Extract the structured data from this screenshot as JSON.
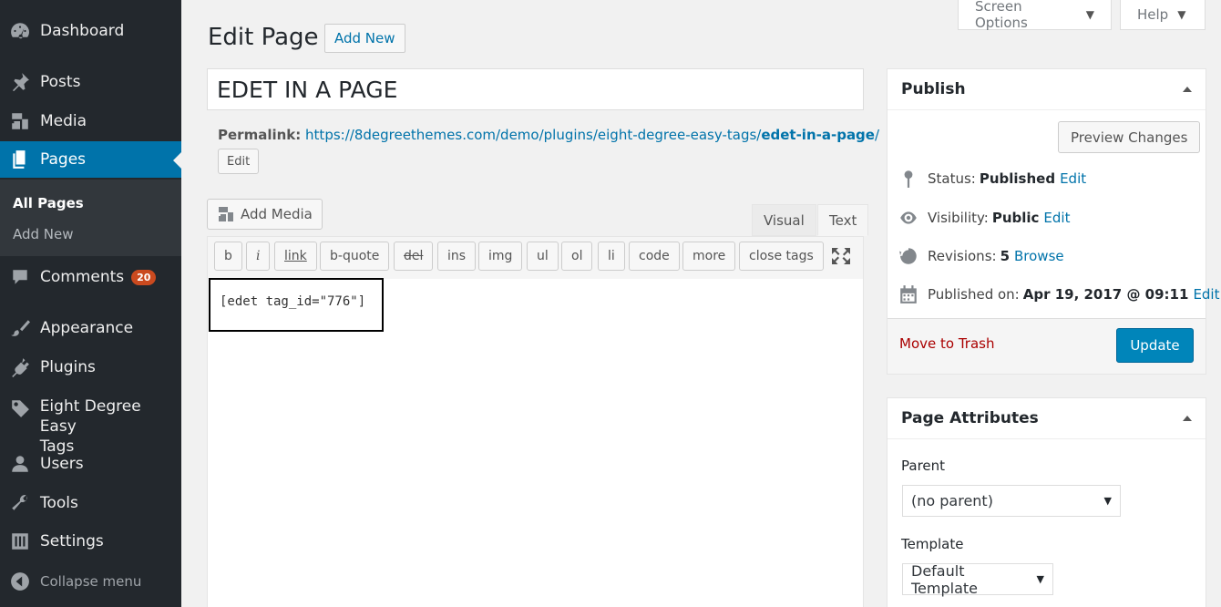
{
  "sidebar": {
    "dashboard": "Dashboard",
    "posts": "Posts",
    "media": "Media",
    "pages": "Pages",
    "submenu": {
      "all_pages": "All Pages",
      "add_new": "Add New"
    },
    "comments": "Comments",
    "comments_count": "20",
    "appearance": "Appearance",
    "plugins": "Plugins",
    "eight_degree_line1": "Eight Degree Easy",
    "eight_degree_line2": "Tags",
    "users": "Users",
    "tools": "Tools",
    "settings": "Settings",
    "collapse": "Collapse menu"
  },
  "top": {
    "screen_options": "Screen Options",
    "help": "Help"
  },
  "header": {
    "title": "Edit Page",
    "add_new": "Add New"
  },
  "post": {
    "title": "EDET IN A PAGE",
    "permalink_label": "Permalink:",
    "permalink_base": "https://8degreethemes.com/demo/plugins/eight-degree-easy-tags/",
    "permalink_slug": "edet-in-a-page",
    "permalink_end": "/",
    "edit_button": "Edit"
  },
  "editor": {
    "add_media": "Add Media",
    "tab_visual": "Visual",
    "tab_text": "Text",
    "buttons": [
      "b",
      "i",
      "link",
      "b-quote",
      "del",
      "ins",
      "img",
      "ul",
      "ol",
      "li",
      "code",
      "more",
      "close tags"
    ],
    "content": "[edet tag_id=\"776\"]"
  },
  "publish": {
    "title": "Publish",
    "preview": "Preview Changes",
    "status_label": "Status:",
    "status_value": "Published",
    "visibility_label": "Visibility:",
    "visibility_value": "Public",
    "revisions_label": "Revisions:",
    "revisions_value": "5",
    "browse": "Browse",
    "published_on_label": "Published on:",
    "published_on_value": "Apr 19, 2017 @ 09:11",
    "edit": "Edit",
    "trash": "Move to Trash",
    "update": "Update"
  },
  "attributes": {
    "title": "Page Attributes",
    "parent_label": "Parent",
    "parent_value": "(no parent)",
    "template_label": "Template",
    "template_value": "Default Template"
  },
  "colors": {
    "sidebar_bg": "#23282d",
    "accent": "#0073aa",
    "badge": "#ca4a1f",
    "update_bg": "#0085ba",
    "trash": "#a00"
  }
}
